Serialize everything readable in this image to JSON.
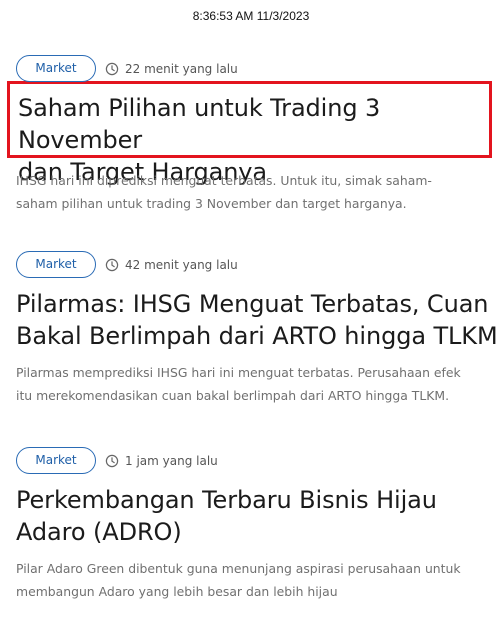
{
  "header": {
    "datetime": "8:36:53 AM 11/3/2023"
  },
  "colors": {
    "badge_accent": "#2a6bb5",
    "highlight_border": "#e3141e",
    "excerpt_text": "#707070"
  },
  "articles": [
    {
      "category": "Market",
      "time": "22 menit yang lalu",
      "title_line1": "Saham Pilihan untuk Trading 3 November",
      "title_line2": "dan Target Harganya",
      "excerpt_line1": "IHSG hari ini diprediksi menguat terbatas. Untuk itu, simak saham-",
      "excerpt_line2": "saham pilihan untuk trading 3 November dan target harganya.",
      "highlighted": true
    },
    {
      "category": "Market",
      "time": "42 menit yang lalu",
      "title_line1": "Pilarmas: IHSG Menguat Terbatas, Cuan",
      "title_line2": "Bakal Berlimpah dari ARTO hingga TLKM",
      "excerpt_line1": "Pilarmas memprediksi IHSG hari ini menguat terbatas. Perusahaan efek",
      "excerpt_line2": "itu merekomendasikan cuan bakal berlimpah dari ARTO hingga TLKM.",
      "highlighted": false
    },
    {
      "category": "Market",
      "time": "1 jam yang lalu",
      "title_line1": "Perkembangan Terbaru Bisnis Hijau",
      "title_line2": "Adaro (ADRO)",
      "excerpt_line1": "Pilar Adaro Green dibentuk guna menunjang aspirasi perusahaan untuk",
      "excerpt_line2": "membangun Adaro yang lebih besar dan lebih hijau",
      "highlighted": false
    }
  ],
  "icons": {
    "time": "clock-icon"
  }
}
